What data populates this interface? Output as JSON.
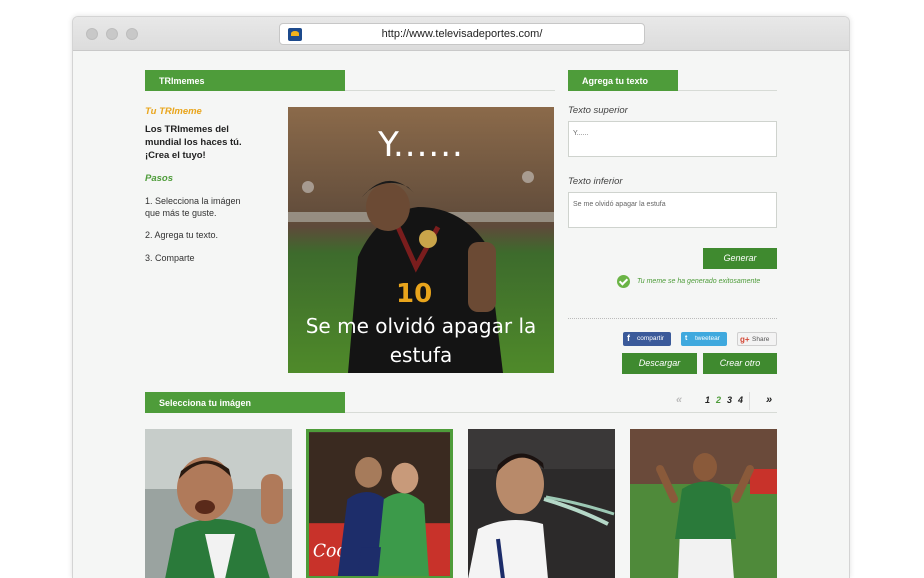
{
  "browser": {
    "url": "http://www.televisadeportes.com/"
  },
  "section_left": {
    "tab_label": "TRImemes",
    "tu_title": "Tu TRImeme",
    "description": "Los TRImemes del mundial los haces tú. ¡Crea el tuyo!",
    "pasos_title": "Pasos",
    "steps": [
      "1. Selecciona la imágen que más te guste.",
      "2. Agrega tu texto.",
      "3. Comparte"
    ]
  },
  "meme": {
    "top_text": "Y......",
    "bottom_text": "Se me olvidó apagar la estufa"
  },
  "section_right": {
    "tab_label": "Agrega tu texto",
    "top_label": "Texto superior",
    "top_value": "Y......",
    "bottom_label": "Texto inferior",
    "bottom_value": "Se me olvidó apagar la estufa",
    "generate_label": "Generar",
    "success_message": "Tu meme se ha generado exitosamente",
    "share": {
      "facebook": "compartir",
      "twitter": "tweetear",
      "gplus": "Share"
    },
    "download_label": "Descargar",
    "create_label": "Crear otro"
  },
  "gallery": {
    "tab_label": "Selecciona tu imágen",
    "pager": {
      "prev": "«",
      "pages": [
        "1",
        "2",
        "3",
        "4"
      ],
      "current": "2",
      "next": "»"
    },
    "selected_index": 1
  },
  "colors": {
    "accent": "#4e9c3a",
    "button": "#3f8a2f",
    "subtitle_orange": "#e9a51c"
  }
}
